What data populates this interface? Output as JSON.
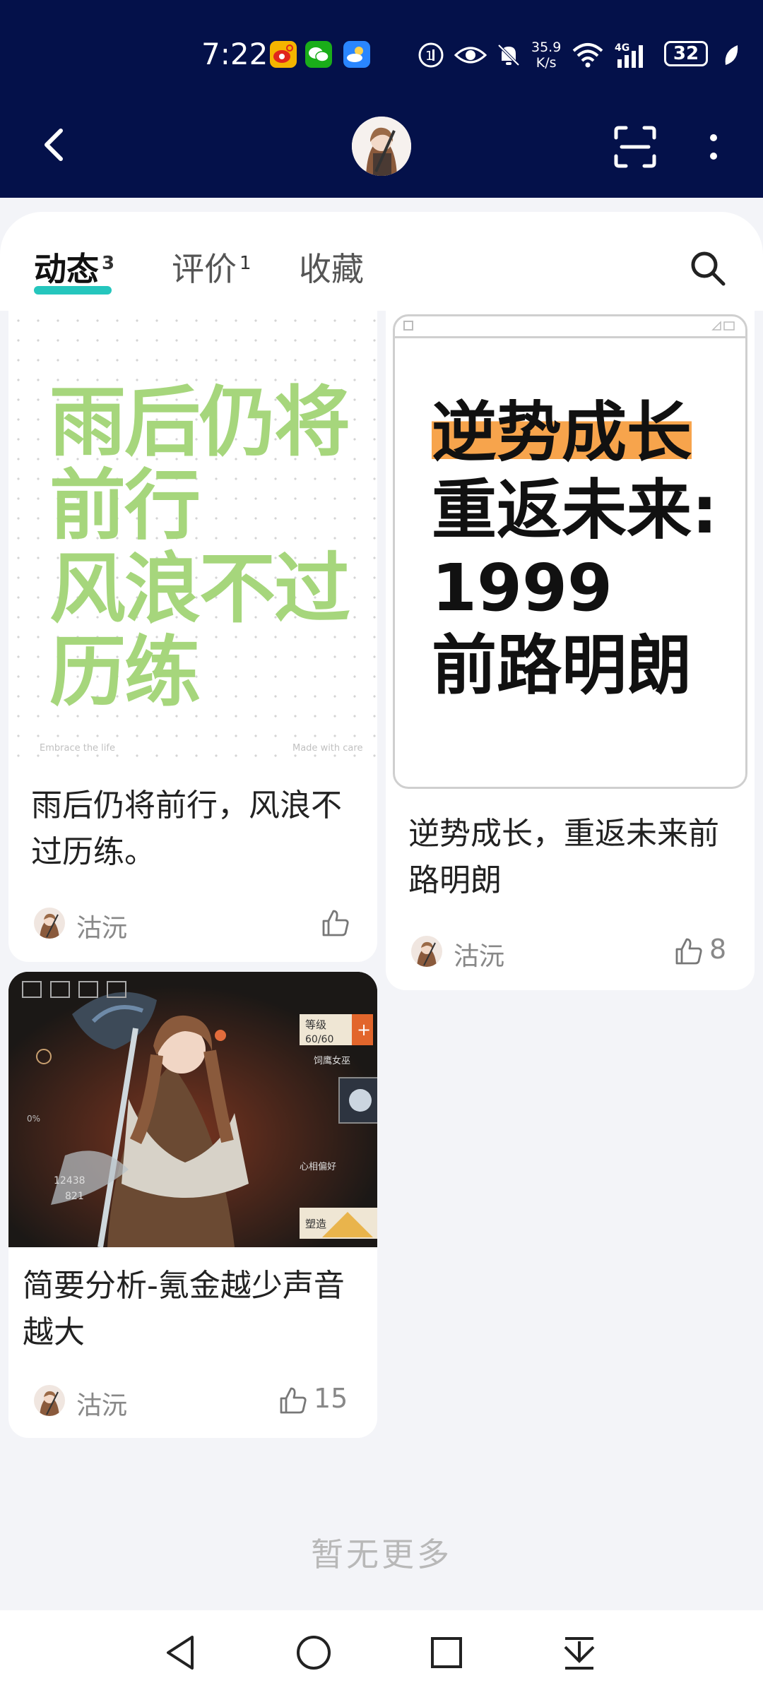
{
  "status_bar": {
    "time": "7:22",
    "speed_value": "35.9",
    "speed_unit": "K/s",
    "network": "4G",
    "battery": "32",
    "apps": [
      "weibo-icon",
      "wechat-icon",
      "weather-icon"
    ],
    "icons": [
      "hd-icon",
      "eye-icon",
      "mute-icon",
      "wifi-icon",
      "signal-icon",
      "battery-icon",
      "leaf-icon"
    ]
  },
  "header": {
    "back_icon": "back-arrow-icon",
    "scan_icon": "scan-icon",
    "more_icon": "more-vertical-icon"
  },
  "tabs": [
    {
      "label": "动态",
      "badge": "3",
      "active": true
    },
    {
      "label": "评价",
      "badge": "1",
      "active": false
    },
    {
      "label": "收藏",
      "badge": "",
      "active": false
    }
  ],
  "posts": [
    {
      "poster_lines": [
        "雨后仍将",
        "前行",
        "风浪不过",
        "历练"
      ],
      "poster_foot_left": "Embrace the life",
      "poster_foot_right": "Made with care",
      "title": "雨后仍将前行，风浪不过历练。",
      "author": "沽沅",
      "likes": ""
    },
    {
      "poster_lines": [
        "逆势成长",
        "重返未来:",
        "1999",
        "前路明朗"
      ],
      "title": "逆势成长，重返未来前路明朗",
      "author": "沽沅",
      "likes": "8"
    },
    {
      "game_labels": {
        "level": "等级",
        "level_value": "60/60",
        "field1": "12438",
        "field2": "821",
        "tag": "饲鹰女巫",
        "pct": "0%",
        "fav": "心相偏好",
        "bottom": "塑造"
      },
      "title": "简要分析-氪金越少声音越大",
      "author": "沽沅",
      "likes": "15"
    }
  ],
  "footer": {
    "no_more": "暂无更多"
  },
  "colors": {
    "header_bg": "#04114a",
    "accent": "#25c6bd",
    "poster_green": "#a6d67c",
    "highlight_orange": "#f7a44c"
  }
}
